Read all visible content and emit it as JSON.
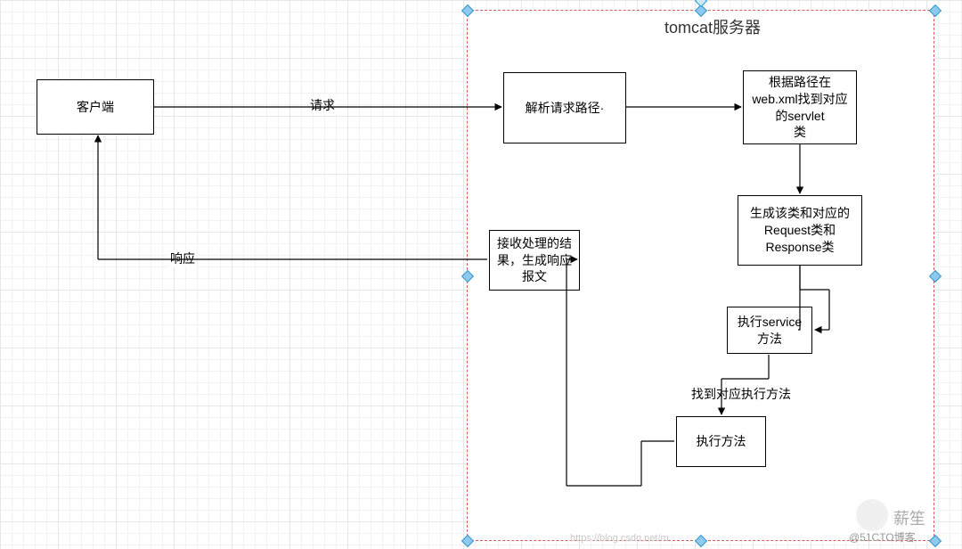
{
  "container": {
    "title": "tomcat服务器"
  },
  "nodes": {
    "client": "客户端",
    "parse_path": "解析请求路径·",
    "find_servlet": "根据路径在\nweb.xml找到对应\n的servlet\n类",
    "gen_classes": "生成该类和对应的\nRequest类和\nResponse类",
    "exec_service": "执行service\n方法",
    "exec_method": "执行方法",
    "build_response": "接收处理的结\n果，生成响应\n报文"
  },
  "edges": {
    "request": "请求",
    "response": "响应",
    "find_exec": "找到对应执行方法"
  },
  "watermark": {
    "left": "https://blog.csdn.net/m",
    "right": "@51CTO博客",
    "brand": "薪笙"
  }
}
